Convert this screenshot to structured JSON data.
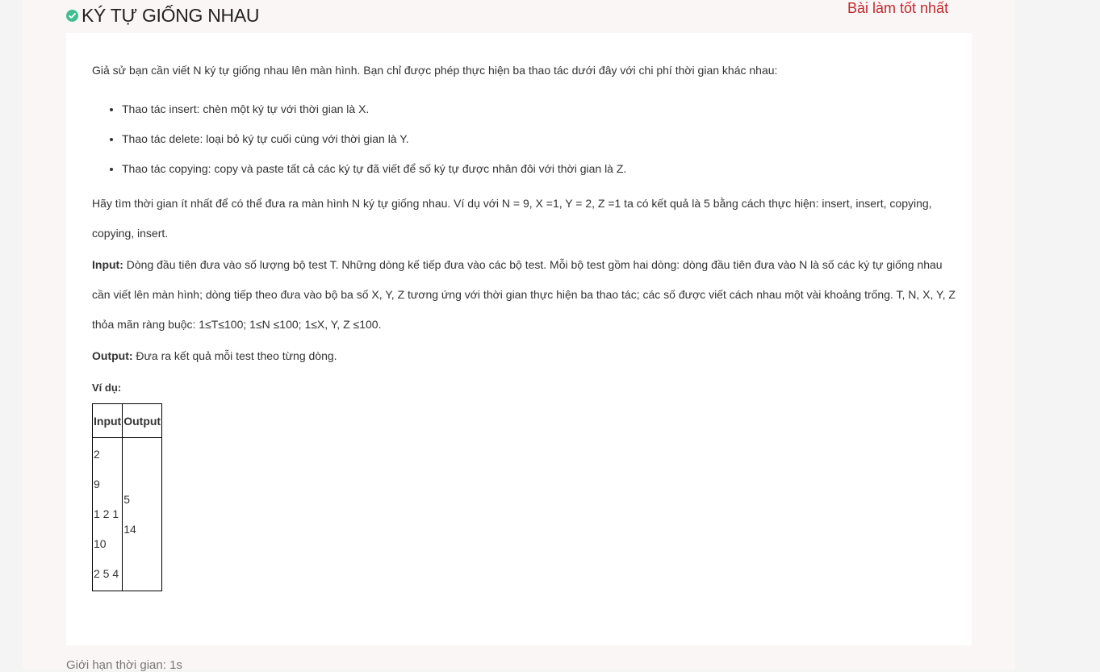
{
  "problem": {
    "title": "KÝ TỰ GIỐNG NHAU",
    "best_solution_link": "Bài làm tốt nhất"
  },
  "statement": {
    "intro": "Giả sử bạn cần viết N ký tự giống nhau lên màn hình. Bạn chỉ được phép thực hiện ba thao tác dưới đây với chi phí thời gian khác nhau:",
    "operations": [
      "Thao tác insert: chèn một ký tự với thời gian là X.",
      "Thao tác delete: loại bỏ ký tự cuối cùng với thời gian là Y.",
      "Thao tác copying: copy và paste tất cả các ký tự đã viết để số ký tự được nhân đôi với thời gian là Z."
    ],
    "hint": "Hãy tìm thời gian ít nhất để có thể đưa ra màn hình N ký tự giống nhau. Ví dụ với N = 9, X =1, Y = 2, Z =1 ta có kết quả là 5 bằng cách thực hiện: insert, insert, copying, copying, insert.",
    "input_label": "Input:",
    "input_text": " Dòng đầu tiên đưa vào số lượng bộ test T. Những dòng kế tiếp đưa vào các bộ test. Mỗi bộ test gồm hai dòng: dòng đầu tiên đưa vào N là số các ký tự giống nhau cần viết lên màn hình; dòng tiếp theo đưa vào bộ ba số X, Y, Z tương ứng với thời gian thực hiện ba thao tác; các số được viết cách nhau một vài khoảng trống.  T, N, X, Y, Z thỏa mãn ràng buộc: 1≤T≤100;  1≤N ≤100; 1≤X, Y, Z ≤100.",
    "output_label": "Output:",
    "output_text": " Đưa ra kết quả mỗi test theo từng dòng.",
    "example_label": "Ví dụ:"
  },
  "example_table": {
    "headers": [
      "Input",
      "Output"
    ],
    "input_lines": [
      "2",
      "9",
      "1 2 1",
      "10",
      "2 5 4"
    ],
    "output_lines": [
      "5",
      "14"
    ]
  },
  "footer": {
    "time_limit": "Giới hạn thời gian: 1s"
  },
  "colors": {
    "accent_red": "#c0282d",
    "check_green": "#3fbf8f"
  }
}
